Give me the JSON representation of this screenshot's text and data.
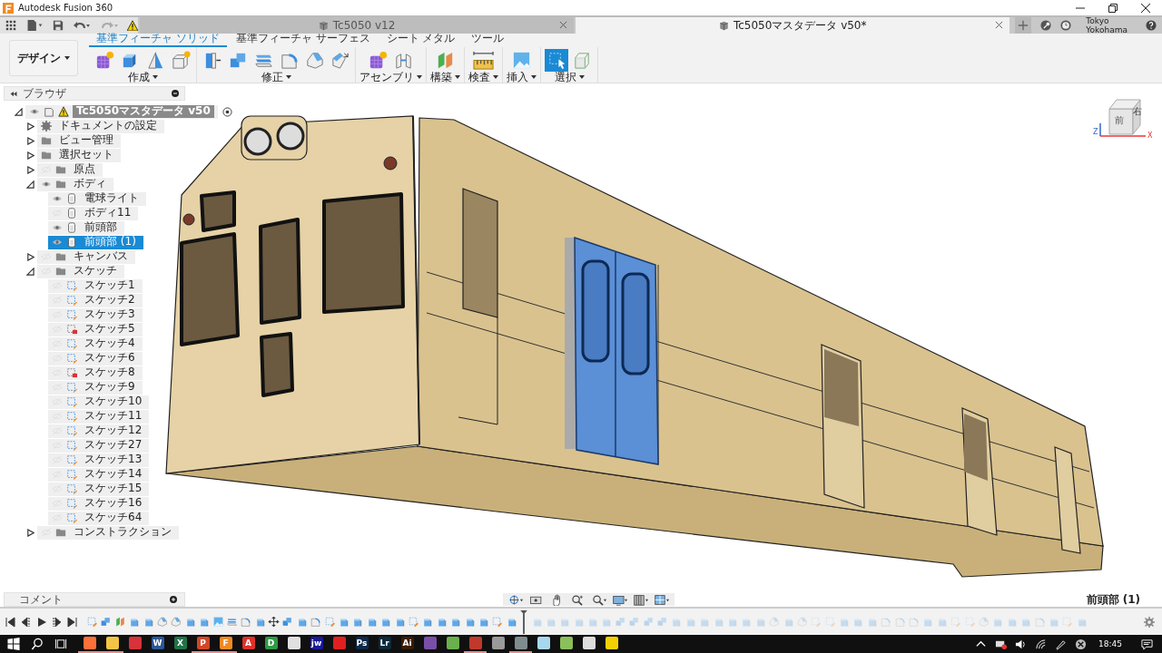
{
  "title_bar": {
    "app_name": "Autodesk Fusion 360"
  },
  "document_tabs": [
    {
      "title": "Tc5050 v12",
      "selected": false
    },
    {
      "title": "Tc5050マスタデータ v50*",
      "selected": true
    }
  ],
  "user": {
    "name": "Tokyo Yokohama"
  },
  "workspace": {
    "label": "デザイン"
  },
  "ribbon_tabs": [
    {
      "label": "基準フィーチャ ソリッド",
      "selected": true
    },
    {
      "label": "基準フィーチャ サーフェス",
      "selected": false
    },
    {
      "label": "シート メタル",
      "selected": false
    },
    {
      "label": "ツール",
      "selected": false
    }
  ],
  "tool_groups": [
    {
      "label": "作成",
      "tools": [
        {
          "kind": "component",
          "selected": false
        },
        {
          "kind": "extrude",
          "selected": false
        },
        {
          "kind": "revolve",
          "selected": false
        },
        {
          "kind": "boxstar",
          "selected": false
        }
      ]
    },
    {
      "label": "修正",
      "tools": [
        {
          "kind": "presspull",
          "selected": false
        },
        {
          "kind": "combine",
          "selected": false
        },
        {
          "kind": "shell",
          "selected": false
        },
        {
          "kind": "fillet",
          "selected": false
        },
        {
          "kind": "chamfer",
          "selected": false
        },
        {
          "kind": "scale",
          "selected": false
        }
      ]
    },
    {
      "label": "アセンブリ",
      "tools": [
        {
          "kind": "component",
          "selected": false
        },
        {
          "kind": "joint",
          "selected": false
        }
      ]
    },
    {
      "label": "構築",
      "tools": [
        {
          "kind": "plane",
          "selected": false
        }
      ]
    },
    {
      "label": "検査",
      "tools": [
        {
          "kind": "measure",
          "selected": false
        }
      ]
    },
    {
      "label": "挿入",
      "tools": [
        {
          "kind": "image",
          "selected": false
        }
      ]
    },
    {
      "label": "選択",
      "tools": [
        {
          "kind": "select",
          "selected": true
        },
        {
          "kind": "box",
          "selected": false
        }
      ]
    }
  ],
  "browser": {
    "title": "ブラウザ",
    "tree": [
      {
        "label": "Tc5050マスタデータ v50",
        "kind": "root",
        "visible": true,
        "expanded": true,
        "selected": false,
        "warning": true,
        "children": [
          {
            "label": "ドキュメントの設定",
            "kind": "settings",
            "expanded": false,
            "selected": false
          },
          {
            "label": "ビュー管理",
            "kind": "folder",
            "expanded": false,
            "selected": false
          },
          {
            "label": "選択セット",
            "kind": "folder",
            "expanded": false,
            "selected": false
          },
          {
            "label": "原点",
            "kind": "folder",
            "visible": false,
            "expanded": false,
            "selected": false
          },
          {
            "label": "ボディ",
            "kind": "folder",
            "visible": true,
            "expanded": true,
            "selected": false,
            "children": [
              {
                "label": "電球ライト",
                "kind": "body",
                "visible": true,
                "selected": false
              },
              {
                "label": "ボディ11",
                "kind": "body",
                "visible": false,
                "selected": false
              },
              {
                "label": "前頭部",
                "kind": "body",
                "visible": true,
                "selected": false
              },
              {
                "label": "前頭部 (1)",
                "kind": "body",
                "visible": true,
                "selected": true
              }
            ]
          },
          {
            "label": "キャンバス",
            "kind": "folder",
            "visible": false,
            "expanded": false,
            "selected": false
          },
          {
            "label": "スケッチ",
            "kind": "folder",
            "visible": false,
            "expanded": true,
            "selected": false,
            "children": [
              {
                "label": "スケッチ1",
                "kind": "sketch",
                "visible": false,
                "selected": false,
                "flagged": false
              },
              {
                "label": "スケッチ2",
                "kind": "sketch",
                "visible": false,
                "selected": false,
                "flagged": false
              },
              {
                "label": "スケッチ3",
                "kind": "sketch",
                "visible": false,
                "selected": false,
                "flagged": false
              },
              {
                "label": "スケッチ5",
                "kind": "sketch",
                "visible": false,
                "selected": false,
                "flagged": true
              },
              {
                "label": "スケッチ4",
                "kind": "sketch",
                "visible": false,
                "selected": false,
                "flagged": false
              },
              {
                "label": "スケッチ6",
                "kind": "sketch",
                "visible": false,
                "selected": false,
                "flagged": false
              },
              {
                "label": "スケッチ8",
                "kind": "sketch",
                "visible": false,
                "selected": false,
                "flagged": true
              },
              {
                "label": "スケッチ9",
                "kind": "sketch",
                "visible": false,
                "selected": false,
                "flagged": false
              },
              {
                "label": "スケッチ10",
                "kind": "sketch",
                "visible": false,
                "selected": false,
                "flagged": false
              },
              {
                "label": "スケッチ11",
                "kind": "sketch",
                "visible": false,
                "selected": false,
                "flagged": false
              },
              {
                "label": "スケッチ12",
                "kind": "sketch",
                "visible": false,
                "selected": false,
                "flagged": false
              },
              {
                "label": "スケッチ27",
                "kind": "sketch",
                "visible": false,
                "selected": false,
                "flagged": false
              },
              {
                "label": "スケッチ13",
                "kind": "sketch",
                "visible": false,
                "selected": false,
                "flagged": false
              },
              {
                "label": "スケッチ14",
                "kind": "sketch",
                "visible": false,
                "selected": false,
                "flagged": false
              },
              {
                "label": "スケッチ15",
                "kind": "sketch",
                "visible": false,
                "selected": false,
                "flagged": false
              },
              {
                "label": "スケッチ16",
                "kind": "sketch",
                "visible": false,
                "selected": false,
                "flagged": false
              },
              {
                "label": "スケッチ64",
                "kind": "sketch",
                "visible": false,
                "selected": false,
                "flagged": false
              }
            ]
          },
          {
            "label": "コンストラクション",
            "kind": "folder",
            "visible": false,
            "expanded": false,
            "selected": false
          }
        ]
      }
    ]
  },
  "viewcube": {
    "front": "前",
    "right": "右",
    "axis_z": "Z",
    "axis_x": "X"
  },
  "comments": {
    "title": "コメント"
  },
  "selection_status": "前頭部 (1)",
  "timeline": {
    "features": [
      {
        "kind": "sketch",
        "rolled_back": false
      },
      {
        "kind": "combine",
        "rolled_back": false
      },
      {
        "kind": "plane",
        "rolled_back": false
      },
      {
        "kind": "body",
        "rolled_back": false
      },
      {
        "kind": "body",
        "rolled_back": false
      },
      {
        "kind": "chamfer",
        "rolled_back": false
      },
      {
        "kind": "chamfer",
        "rolled_back": false
      },
      {
        "kind": "body",
        "rolled_back": false
      },
      {
        "kind": "body",
        "rolled_back": false
      },
      {
        "kind": "image",
        "rolled_back": false
      },
      {
        "kind": "shell",
        "rolled_back": false
      },
      {
        "kind": "fillet",
        "rolled_back": false
      },
      {
        "kind": "body",
        "rolled_back": false
      },
      {
        "kind": "move",
        "rolled_back": false
      },
      {
        "kind": "combine",
        "rolled_back": false
      },
      {
        "kind": "body",
        "rolled_back": false
      },
      {
        "kind": "fillet",
        "rolled_back": false
      },
      {
        "kind": "sketch",
        "rolled_back": false
      },
      {
        "kind": "body",
        "rolled_back": false
      },
      {
        "kind": "body",
        "rolled_back": false
      },
      {
        "kind": "body",
        "rolled_back": false
      },
      {
        "kind": "body",
        "rolled_back": false
      },
      {
        "kind": "body",
        "rolled_back": false
      },
      {
        "kind": "sketch",
        "rolled_back": false
      },
      {
        "kind": "body",
        "rolled_back": false
      },
      {
        "kind": "body",
        "rolled_back": false
      },
      {
        "kind": "body",
        "rolled_back": false
      },
      {
        "kind": "body",
        "rolled_back": false
      },
      {
        "kind": "body",
        "rolled_back": false
      },
      {
        "kind": "sketch",
        "rolled_back": false
      },
      {
        "kind": "body",
        "rolled_back": false
      },
      {
        "kind": "body",
        "rolled_back": true
      },
      {
        "kind": "body",
        "rolled_back": true
      },
      {
        "kind": "body",
        "rolled_back": true
      },
      {
        "kind": "body",
        "rolled_back": true
      },
      {
        "kind": "body",
        "rolled_back": true
      },
      {
        "kind": "body",
        "rolled_back": true
      },
      {
        "kind": "combine",
        "rolled_back": true
      },
      {
        "kind": "combine",
        "rolled_back": true
      },
      {
        "kind": "combine",
        "rolled_back": true
      },
      {
        "kind": "combine",
        "rolled_back": true
      },
      {
        "kind": "body",
        "rolled_back": true
      },
      {
        "kind": "body",
        "rolled_back": true
      },
      {
        "kind": "body",
        "rolled_back": true
      },
      {
        "kind": "body",
        "rolled_back": true
      },
      {
        "kind": "body",
        "rolled_back": true
      },
      {
        "kind": "body",
        "rolled_back": true
      },
      {
        "kind": "body",
        "rolled_back": true
      },
      {
        "kind": "chamfer",
        "rolled_back": true
      },
      {
        "kind": "body",
        "rolled_back": true
      },
      {
        "kind": "chamfer",
        "rolled_back": true
      },
      {
        "kind": "sketch",
        "rolled_back": true
      },
      {
        "kind": "sketch",
        "rolled_back": true
      },
      {
        "kind": "body",
        "rolled_back": true
      },
      {
        "kind": "body",
        "rolled_back": true
      },
      {
        "kind": "body",
        "rolled_back": true
      },
      {
        "kind": "fillet",
        "rolled_back": true
      },
      {
        "kind": "fillet",
        "rolled_back": true
      },
      {
        "kind": "fillet",
        "rolled_back": true
      },
      {
        "kind": "body",
        "rolled_back": true
      },
      {
        "kind": "body",
        "rolled_back": true
      },
      {
        "kind": "sketch",
        "rolled_back": true
      },
      {
        "kind": "sketch",
        "rolled_back": true
      },
      {
        "kind": "chamfer",
        "rolled_back": true
      },
      {
        "kind": "body",
        "rolled_back": true
      },
      {
        "kind": "body",
        "rolled_back": true
      },
      {
        "kind": "body",
        "rolled_back": true
      },
      {
        "kind": "fillet",
        "rolled_back": true
      },
      {
        "kind": "body",
        "rolled_back": true
      },
      {
        "kind": "sketch",
        "rolled_back": true
      },
      {
        "kind": "body",
        "rolled_back": true
      }
    ]
  },
  "taskbar": {
    "apps": [
      {
        "color": "#ff7139",
        "running": true
      },
      {
        "color": "#f3c545",
        "running": true
      },
      {
        "color": "#d9323a",
        "running": false
      },
      {
        "glyph": "W",
        "color": "#2b579a",
        "running": false
      },
      {
        "glyph": "X",
        "color": "#217346",
        "running": false
      },
      {
        "glyph": "P",
        "color": "#d24726",
        "running": true
      },
      {
        "glyph": "F",
        "color": "#f08a24",
        "running": true
      },
      {
        "glyph": "A",
        "color": "#e0312b",
        "running": false
      },
      {
        "glyph": "D",
        "color": "#2f9a45",
        "running": false
      },
      {
        "color": "#e0e0e0",
        "running": false
      },
      {
        "glyph": "jw",
        "color": "#1a1a9a",
        "running": false
      },
      {
        "color": "#e02020",
        "running": false
      },
      {
        "glyph": "Ps",
        "color": "#0b2a4a",
        "running": false
      },
      {
        "glyph": "Lr",
        "color": "#0b2a3a",
        "running": false
      },
      {
        "glyph": "Ai",
        "color": "#3a1c00",
        "running": false
      },
      {
        "color": "#7a4fa8",
        "running": false
      },
      {
        "color": "#6ab04c",
        "running": false
      },
      {
        "color": "#c0392b",
        "running": true
      },
      {
        "color": "#9a9a9a",
        "running": false
      },
      {
        "color": "#7f8c8d",
        "running": true
      },
      {
        "color": "#a8d8f0",
        "running": false
      },
      {
        "color": "#8bbf5a",
        "running": false
      },
      {
        "color": "#dddddd",
        "running": false
      },
      {
        "color": "#f5d000",
        "running": false
      }
    ],
    "clock": "18:45"
  }
}
